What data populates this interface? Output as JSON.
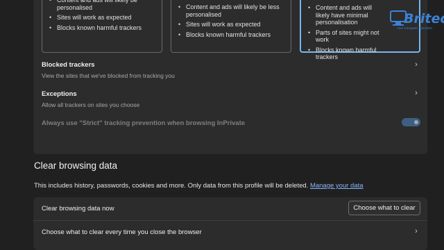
{
  "tracking": {
    "cards": [
      {
        "items": [
          "Content and ads will likely be personalised",
          "Sites will work as expected",
          "Blocks known harmful trackers"
        ]
      },
      {
        "items": [
          "Content and ads will likely be less personalised",
          "Sites will work as expected",
          "Blocks known harmful trackers"
        ]
      },
      {
        "items": [
          "Content and ads will likely have minimal personalisation",
          "Parts of sites might not work",
          "Blocks known harmful trackers"
        ]
      }
    ],
    "blocked": {
      "title": "Blocked trackers",
      "subtitle": "View the sites that we've blocked from tracking you"
    },
    "exceptions": {
      "title": "Exceptions",
      "subtitle": "Allow all trackers on sites you choose"
    },
    "strict_inprivate": {
      "label": "Always use \"Strict\" tracking prevention when browsing InPrivate",
      "enabled": true
    }
  },
  "clear": {
    "heading": "Clear browsing data",
    "description": "This includes history, passwords, cookies and more. Only data from this profile will be deleted.",
    "manage_link": "Manage your data",
    "now_label": "Clear browsing data now",
    "choose_button": "Choose what to clear",
    "every_time_label": "Choose what to clear every time you close the browser"
  },
  "watermark": {
    "word": "Britec",
    "tagline": "Your Computer Specialist"
  },
  "colors": {
    "accent": "#77b7f0",
    "link": "#8ab4f8",
    "panel": "#2c2c2c",
    "background": "#202020"
  }
}
